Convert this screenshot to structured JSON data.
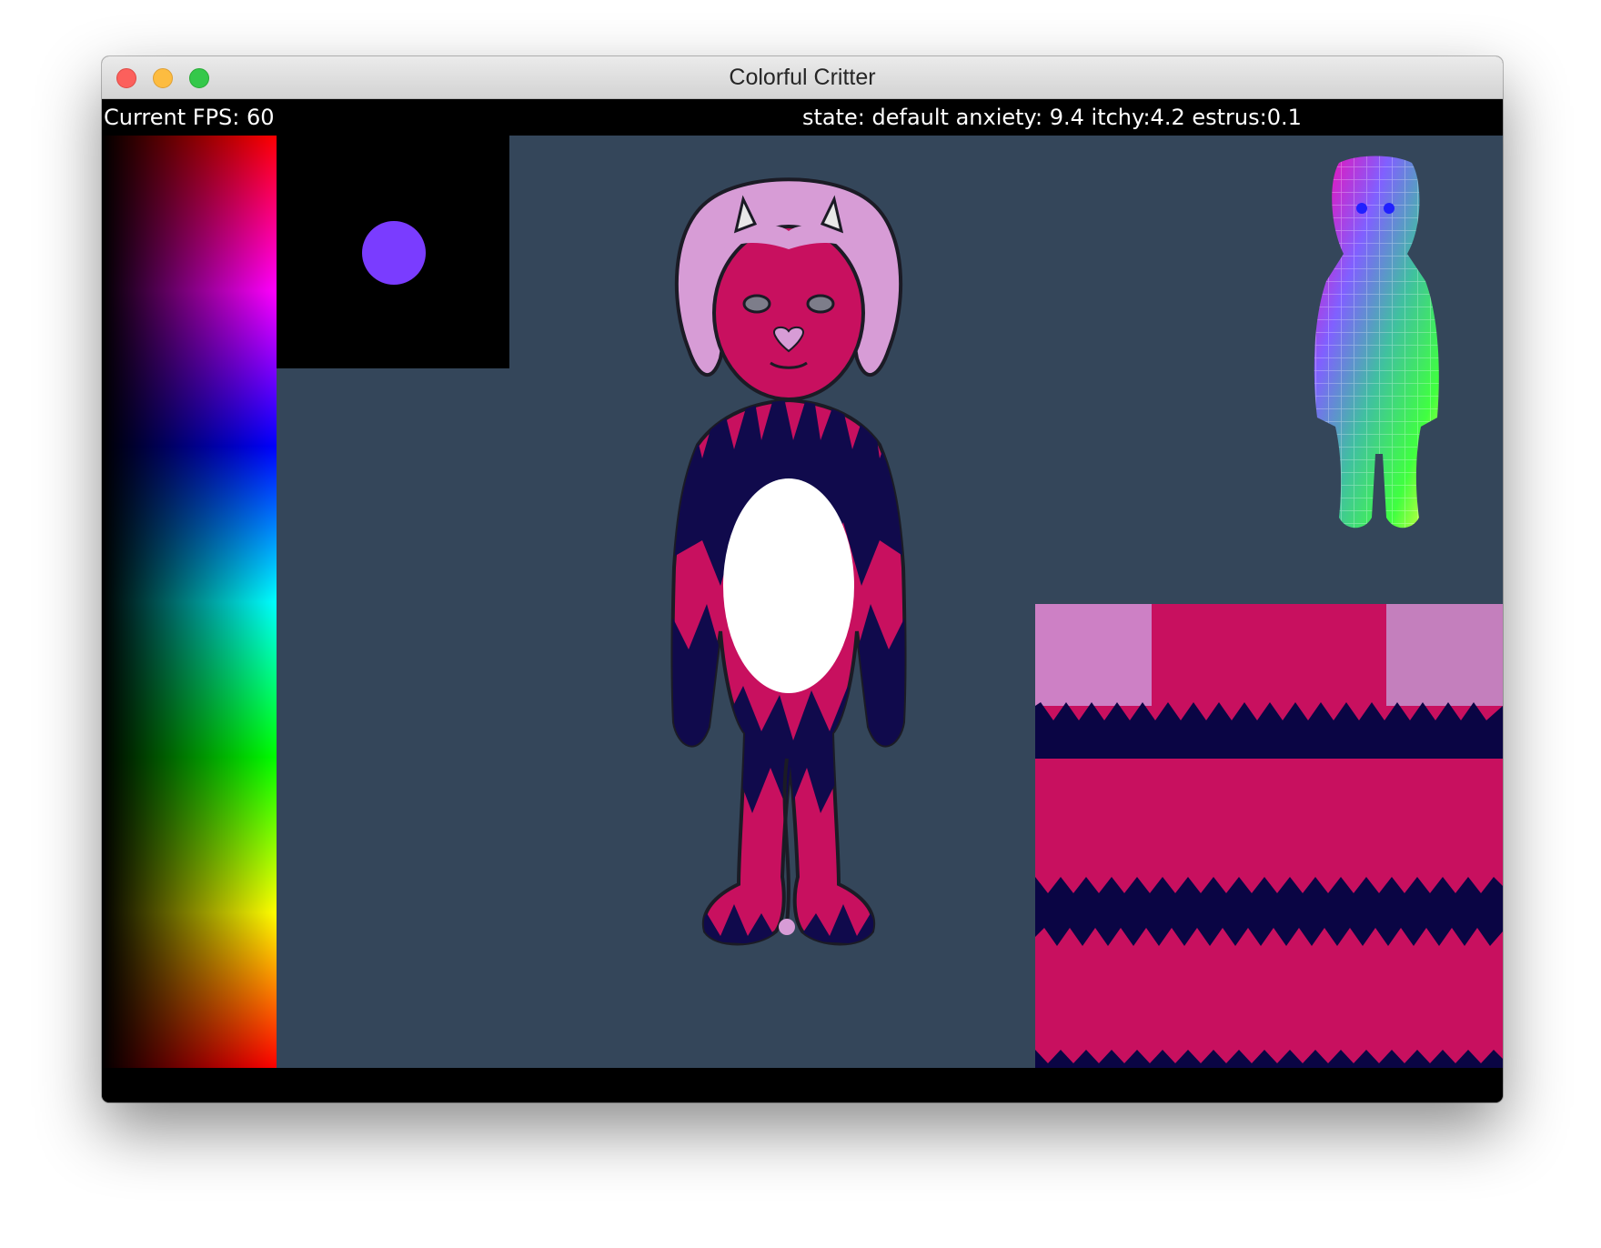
{
  "window": {
    "title": "Colorful Critter",
    "buttons": {
      "close": "close-button",
      "minimize": "minimize-button",
      "zoom": "zoom-button"
    }
  },
  "hud": {
    "fps_text": "Current FPS: 60",
    "state_text": "state: default anxiety: 9.4 itchy:4.2 estrus:0.1"
  },
  "palette": {
    "spectrum_colors": [
      "#ff0000",
      "#ff00ff",
      "#0000ff",
      "#00ffff",
      "#00ff00",
      "#ffff00",
      "#ff0000"
    ],
    "selected_color": "#7a3cff"
  },
  "critter": {
    "body_color": "#c8105f",
    "stripe_color": "#100a4c",
    "hair_color": "#d79cd6",
    "belly_color": "#ffffff",
    "outline_color": "#1b1b25"
  },
  "texture": {
    "top_left_color": "#cd80c5",
    "top_right_color": "#c47fbd",
    "body_color": "#c8105f",
    "stripe_color": "#0a0544"
  },
  "background_color": "#34465a"
}
